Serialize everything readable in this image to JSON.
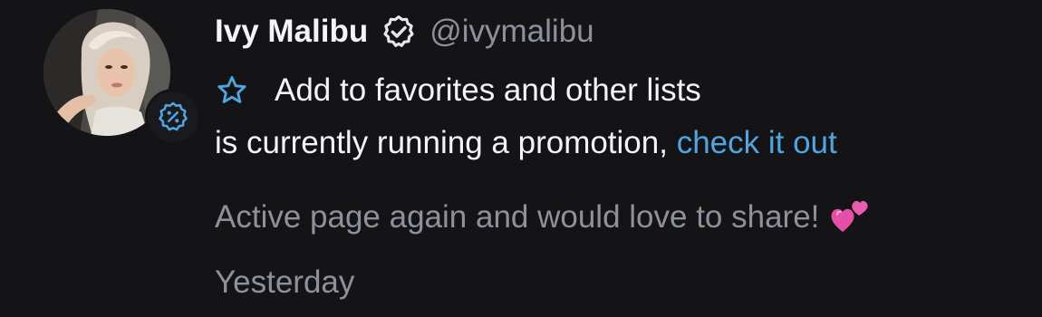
{
  "notification": {
    "user": {
      "name": "Ivy Malibu",
      "handle": "@ivymalibu",
      "verified": true,
      "avatar_icon": "profile-photo",
      "badge_icon": "discount-badge-icon"
    },
    "favorites": {
      "icon": "star-outline-icon",
      "label": "Add to favorites and other lists"
    },
    "promo": {
      "text": "is currently running a promotion, ",
      "link_label": "check it out"
    },
    "message": {
      "text": "Active page again and would love to share!",
      "emoji": "two-hearts-icon"
    },
    "timestamp": "Yesterday",
    "colors": {
      "background": "#141316",
      "primary_text": "#f4f4f6",
      "secondary_text": "#8d919c",
      "link": "#4ea6e0",
      "accent_icon": "#4ea6e0"
    }
  }
}
